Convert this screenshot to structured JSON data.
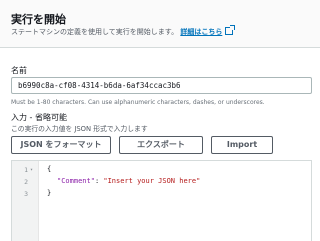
{
  "header": {
    "title": "実行を開始",
    "description": "ステートマシンの定義を使用して実行を開始します。",
    "details_link": "詳細はこちら"
  },
  "name_field": {
    "label": "名前",
    "value": "b6990c8a-cf08-4314-b6da-6af34ccac3b6",
    "constraint": "Must be 1-80 characters. Can use alphanumeric characters, dashes, or underscores."
  },
  "input_field": {
    "label": "入力 - 省略可能",
    "description": "この実行の入力値を JSON 形式で入力します"
  },
  "buttons": {
    "format_json": "JSON をフォーマット",
    "export": "エクスポート",
    "import": "Import"
  },
  "editor": {
    "line_numbers": [
      "1",
      "2",
      "3"
    ],
    "line1": "{",
    "line2_key": "\"Comment\"",
    "line2_sep": ": ",
    "line2_value": "\"Insert your JSON here\"",
    "line3": "}"
  }
}
